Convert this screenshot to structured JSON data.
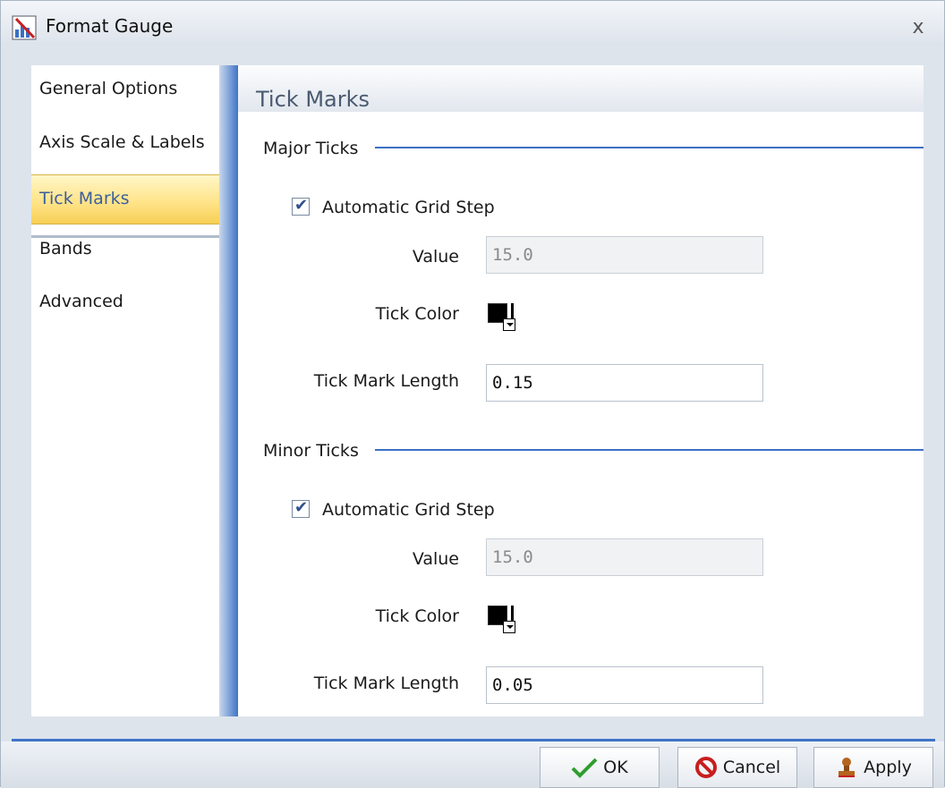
{
  "window": {
    "title": "Format Gauge",
    "close_glyph": "x"
  },
  "nav": {
    "items": [
      {
        "label": "General Options",
        "selected": false
      },
      {
        "label": "Axis Scale & Labels",
        "selected": false
      },
      {
        "label": "Tick Marks",
        "selected": true
      },
      {
        "label": "Bands",
        "selected": false
      },
      {
        "label": "Advanced",
        "selected": false
      }
    ]
  },
  "panel": {
    "title": "Tick Marks",
    "major": {
      "section_label": "Major Ticks",
      "auto_grid_label": "Automatic Grid Step",
      "auto_grid_checked": true,
      "value_label": "Value",
      "value": "15.0",
      "tick_color_label": "Tick Color",
      "tick_color": "#000000",
      "tick_length_label": "Tick Mark Length",
      "tick_length": "0.15"
    },
    "minor": {
      "section_label": "Minor Ticks",
      "auto_grid_label": "Automatic Grid Step",
      "auto_grid_checked": true,
      "value_label": "Value",
      "value": "15.0",
      "tick_color_label": "Tick Color",
      "tick_color": "#000000",
      "tick_length_label": "Tick Mark Length",
      "tick_length": "0.05"
    }
  },
  "buttons": {
    "ok": "OK",
    "cancel": "Cancel",
    "apply": "Apply"
  },
  "colors": {
    "accent": "#3e74c7",
    "selected_nav": "#ffe48a"
  },
  "icons": {
    "title": "gauge-chart-icon",
    "ok": "checkmark-icon",
    "cancel": "no-entry-icon",
    "apply": "stamp-icon"
  }
}
